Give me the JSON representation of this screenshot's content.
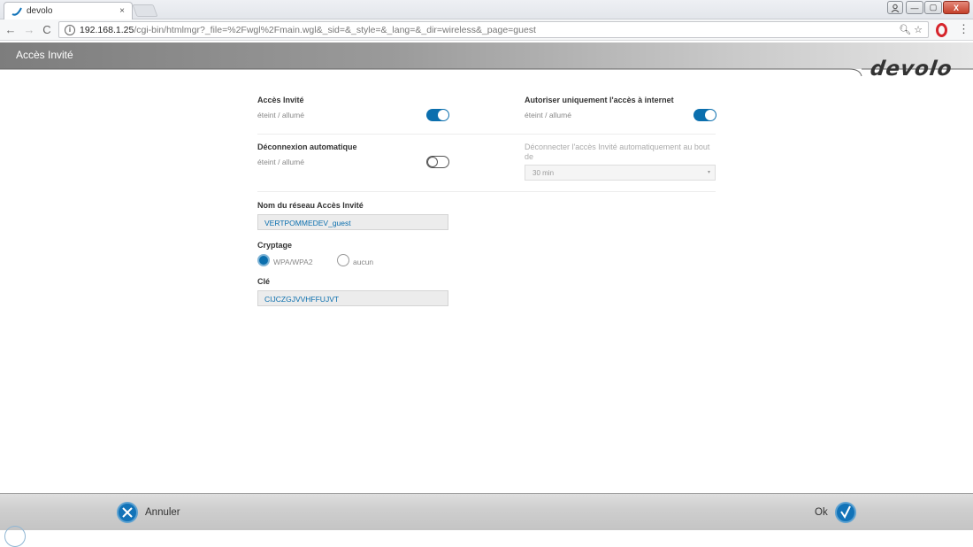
{
  "browser": {
    "tab_title": "devolo",
    "tab_close": "×",
    "url_host": "192.168.1.25",
    "url_path": "/cgi-bin/htmlmgr?_file=%2Fwgl%2Fmain.wgl&_sid=&_style=&_lang=&_dir=wireless&_page=guest",
    "info_glyph": "i",
    "back_glyph": "←",
    "forward_glyph": "→",
    "reload_glyph": "C",
    "zoom_star": "🔍︎ ☆",
    "menu_glyph": "⋮",
    "win_min": "—",
    "win_max": "▢",
    "win_close": "X"
  },
  "header": {
    "title": "Accès Invité",
    "logo": "devolo"
  },
  "form": {
    "guest_access": {
      "label": "Accès Invité",
      "sub": "éteint / allumé",
      "on": true
    },
    "internet_only": {
      "label": "Autoriser uniquement l'accès à internet",
      "sub": "éteint / allumé",
      "on": true
    },
    "auto_disconnect": {
      "label": "Déconnexion automatique",
      "sub": "éteint / allumé",
      "on": false
    },
    "disconnect_after": {
      "label": "Déconnecter l'accès Invité automatiquement au bout de",
      "value": "30 min",
      "caret": "▾"
    },
    "ssid": {
      "label": "Nom du réseau Accès Invité",
      "value": "VERTPOMMEDEV_guest"
    },
    "encryption": {
      "label": "Cryptage",
      "options": [
        "WPA/WPA2",
        "aucun"
      ],
      "selected": "WPA/WPA2"
    },
    "key": {
      "label": "Clé",
      "value": "CIJCZGJVVHFFUJVT"
    }
  },
  "footer": {
    "cancel": "Annuler",
    "ok": "Ok"
  },
  "colors": {
    "accent": "#0b6fae"
  }
}
